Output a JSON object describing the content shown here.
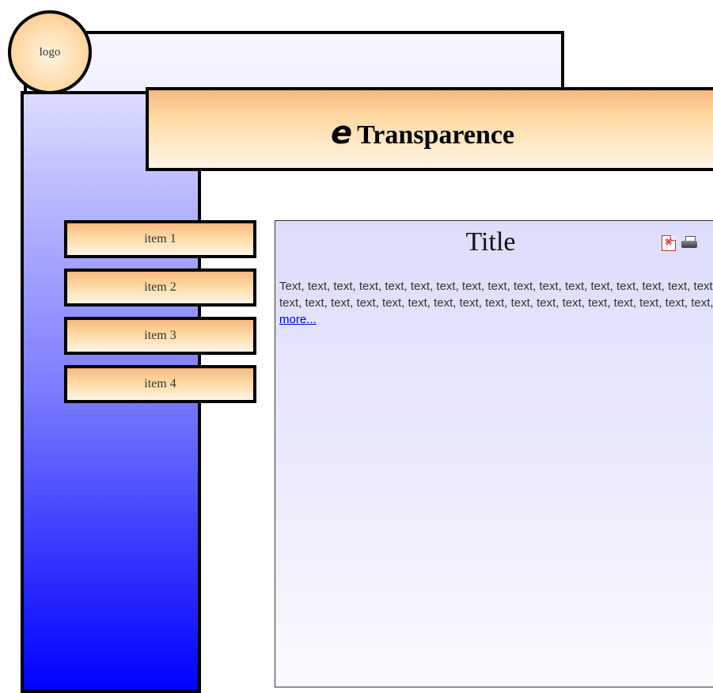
{
  "logo": {
    "label": "logo"
  },
  "header": {
    "prefix": "e",
    "title": "Transparence"
  },
  "nav": {
    "items": [
      "item 1",
      "item 2",
      "item 3",
      "item 4"
    ]
  },
  "article": {
    "title": "Title",
    "pdf_icon_glyph": "⌘",
    "body": "Text, text, text, text, text, text, text, text, text, text, text, text, text, text, text, text, text, text, text, text, text, text, text, text, text, text, text, text, text, text, text, text, text, text,",
    "more_link": "more..."
  },
  "colors": {
    "header_gradient_top": "#f6b980",
    "header_gradient_bottom": "#fff5e7",
    "sidebar_gradient_top": "#dcdcff",
    "sidebar_gradient_bottom": "#0000ff",
    "link": "#0000ee"
  },
  "icons": [
    "pdf-icon",
    "print-icon"
  ]
}
